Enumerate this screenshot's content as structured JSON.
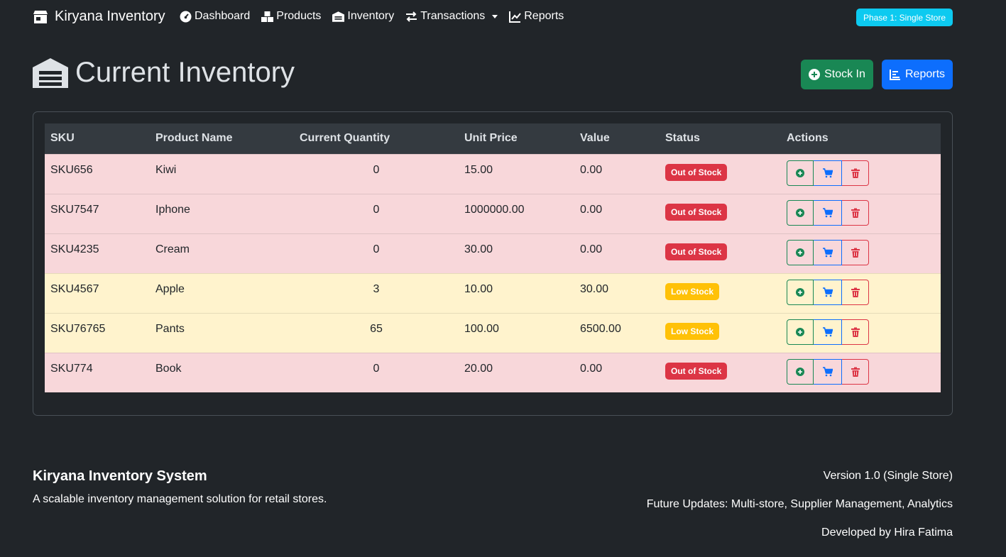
{
  "navbar": {
    "brand": "Kiryana Inventory",
    "items": [
      {
        "label": "Dashboard",
        "icon": "gauge-icon"
      },
      {
        "label": "Products",
        "icon": "boxes-icon"
      },
      {
        "label": "Inventory",
        "icon": "warehouse-icon"
      },
      {
        "label": "Transactions",
        "icon": "exchange-icon"
      },
      {
        "label": "Reports",
        "icon": "chart-line-icon"
      }
    ],
    "phase_badge": "Phase 1: Single Store"
  },
  "page": {
    "title": "Current Inventory",
    "stock_in_label": "Stock In",
    "reports_label": "Reports"
  },
  "table": {
    "headers": [
      "SKU",
      "Product Name",
      "Current Quantity",
      "Unit Price",
      "Value",
      "Status",
      "Actions"
    ],
    "rows": [
      {
        "sku": "SKU656",
        "name": "Kiwi",
        "qty": "0",
        "price": "15.00",
        "value": "0.00",
        "status": "Out of Stock"
      },
      {
        "sku": "SKU7547",
        "name": "Iphone",
        "qty": "0",
        "price": "1000000.00",
        "value": "0.00",
        "status": "Out of Stock"
      },
      {
        "sku": "SKU4235",
        "name": "Cream",
        "qty": "0",
        "price": "30.00",
        "value": "0.00",
        "status": "Out of Stock"
      },
      {
        "sku": "SKU4567",
        "name": "Apple",
        "qty": "3",
        "price": "10.00",
        "value": "30.00",
        "status": "Low Stock"
      },
      {
        "sku": "SKU76765",
        "name": "Pants",
        "qty": "65",
        "price": "100.00",
        "value": "6500.00",
        "status": "Low Stock"
      },
      {
        "sku": "SKU774",
        "name": "Book",
        "qty": "0",
        "price": "20.00",
        "value": "0.00",
        "status": "Out of Stock"
      }
    ]
  },
  "footer": {
    "title": "Kiryana Inventory System",
    "description": "A scalable inventory management solution for retail stores.",
    "version": "Version 1.0 (Single Store)",
    "future": "Future Updates: Multi-store, Supplier Management, Analytics",
    "developer": "Developed by Hira Fatima"
  },
  "colors": {
    "background": "#212529",
    "success": "#198754",
    "primary": "#0d6efd",
    "danger": "#dc3545",
    "warning": "#ffc107",
    "info": "#0dcaf0",
    "row_danger": "#f8d7da",
    "row_warning": "#fff3cd"
  }
}
